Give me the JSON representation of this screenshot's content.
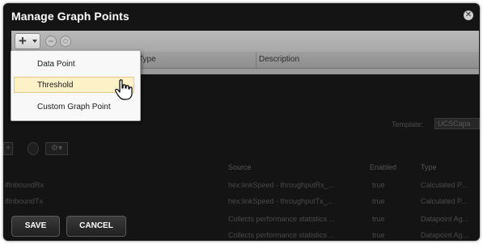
{
  "dialog": {
    "title": "Manage Graph Points",
    "close_icon": "close-icon"
  },
  "toolbar": {
    "add_icon": "plus-icon",
    "remove_icon": "minus-icon",
    "edit_icon": "gear-icon"
  },
  "columns": {
    "type": "Type",
    "description": "Description"
  },
  "add_menu": {
    "items": [
      {
        "label": "Data Point",
        "active": false
      },
      {
        "label": "Threshold",
        "active": true
      },
      {
        "label": "Custom Graph Point",
        "active": false
      }
    ]
  },
  "background": {
    "template_label": "Template:",
    "template_value": "UCSCapa",
    "headers": {
      "source": "Source",
      "enabled": "Enabled",
      "type": "Type"
    },
    "rows": [
      {
        "name": "ifInboundRx",
        "source": "hex:linkSpeed - throughputRx_...",
        "enabled": "true",
        "type": "Calculated P..."
      },
      {
        "name": "ifInboundTx",
        "source": "hex:linkSpeed - throughputTx_...",
        "enabled": "true",
        "type": "Calculated P..."
      },
      {
        "name": "",
        "source": "Collects performance statistics ...",
        "enabled": "true",
        "type": "Datapoint Ag..."
      },
      {
        "name": "",
        "source": "Collects performance statistics ...",
        "enabled": "true",
        "type": "Datapoint Ag..."
      }
    ]
  },
  "footer": {
    "save_label": "SAVE",
    "cancel_label": "CANCEL"
  },
  "colors": {
    "dialog_bg": "#141414",
    "menu_highlight": "#fdf1c8"
  }
}
